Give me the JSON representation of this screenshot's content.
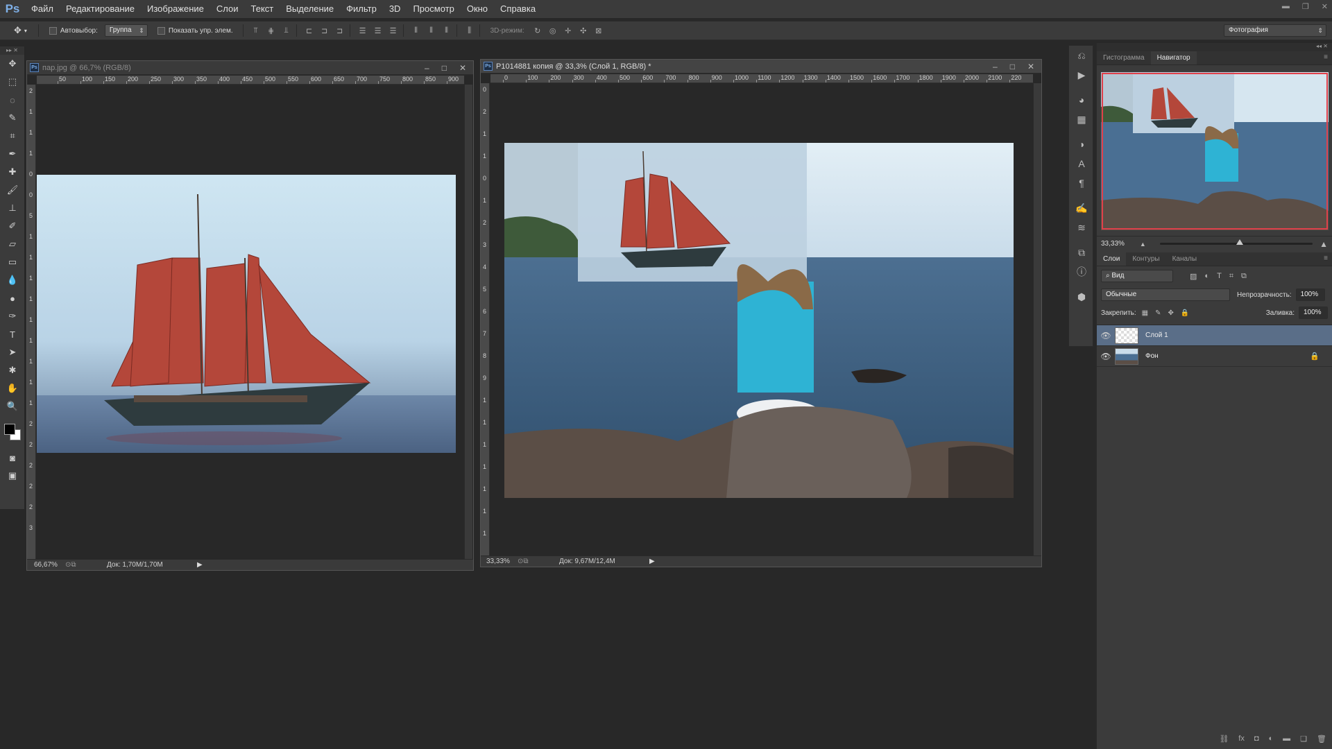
{
  "app": {
    "logo": "Ps"
  },
  "menu": [
    "Файл",
    "Редактирование",
    "Изображение",
    "Слои",
    "Текст",
    "Выделение",
    "Фильтр",
    "3D",
    "Просмотр",
    "Окно",
    "Справка"
  ],
  "options": {
    "autoselect_label": "Автовыбор:",
    "autoselect_value": "Группа",
    "show_controls_label": "Показать упр. элем.",
    "mode3d_label": "3D-режим:",
    "workspace": "Фотография"
  },
  "doc1": {
    "title": "пар.jpg @ 66,7% (RGB/8)",
    "zoom": "66,67%",
    "docsize": "Док: 1,70M/1,70M",
    "ruler_h": [
      "50",
      "100",
      "150",
      "200",
      "250",
      "300",
      "350",
      "400",
      "450",
      "500",
      "550",
      "600",
      "650",
      "700",
      "750",
      "800",
      "850",
      "900"
    ],
    "ruler_v": [
      "2",
      "1",
      "1",
      "1",
      "0",
      "0",
      "5",
      "1",
      "1",
      "1",
      "1",
      "1",
      "1",
      "1",
      "1",
      "1",
      "2",
      "2",
      "2",
      "2",
      "2",
      "3"
    ]
  },
  "doc2": {
    "title": "P1014881 копия @ 33,3% (Слой 1, RGB/8) *",
    "zoom": "33,33%",
    "docsize": "Док: 9,67M/12,4M",
    "ruler_h": [
      "0",
      "100",
      "200",
      "300",
      "400",
      "500",
      "600",
      "700",
      "800",
      "900",
      "1000",
      "1100",
      "1200",
      "1300",
      "1400",
      "1500",
      "1600",
      "1700",
      "1800",
      "1900",
      "2000",
      "2100",
      "220"
    ],
    "ruler_v": [
      "0",
      "2",
      "1",
      "1",
      "0",
      "1",
      "2",
      "3",
      "4",
      "5",
      "6",
      "7",
      "8",
      "9",
      "1",
      "1",
      "1",
      "1",
      "1",
      "1",
      "1"
    ]
  },
  "navigator": {
    "tabs": [
      "Гистограмма",
      "Навигатор"
    ],
    "active_tab": "Навигатор",
    "zoom": "33,33%"
  },
  "layers_panel": {
    "tabs": [
      "Слои",
      "Контуры",
      "Каналы"
    ],
    "filter_label": "Вид",
    "blend_mode": "Обычные",
    "opacity_label": "Непрозрачность:",
    "opacity": "100%",
    "lock_label": "Закрепить:",
    "fill_label": "Заливка:",
    "fill": "100%",
    "layers": [
      {
        "name": "Слой 1",
        "selected": true,
        "locked": false
      },
      {
        "name": "Фон",
        "selected": false,
        "locked": true
      }
    ]
  },
  "colors": {
    "accent": "#5a6e88",
    "nav_frame": "#e0404a",
    "sail": "#b4473a"
  }
}
